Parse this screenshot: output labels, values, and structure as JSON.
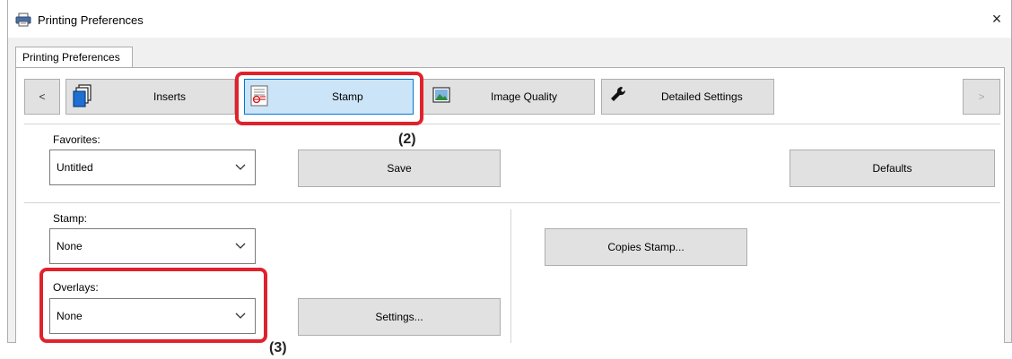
{
  "window": {
    "title": "Printing Preferences",
    "close_glyph": "×"
  },
  "tab": {
    "label": "Printing Preferences"
  },
  "toolbar": {
    "prev_label": "<",
    "next_label": ">",
    "tabs": [
      {
        "label": "Inserts",
        "icon": "pages-icon"
      },
      {
        "label": "Stamp",
        "icon": "stamp-icon",
        "selected": true
      },
      {
        "label": "Image Quality",
        "icon": "image-quality-icon"
      },
      {
        "label": "Detailed Settings",
        "icon": "wrench-icon"
      }
    ]
  },
  "favorites": {
    "label": "Favorites:",
    "value": "Untitled",
    "save_label": "Save",
    "defaults_label": "Defaults"
  },
  "stamp": {
    "label": "Stamp:",
    "value": "None",
    "copies_stamp_label": "Copies Stamp..."
  },
  "overlays": {
    "label": "Overlays:",
    "value": "None",
    "settings_label": "Settings..."
  },
  "annotations": {
    "callout_2": "(2)",
    "callout_3": "(3)",
    "callout_color": "#e0222c"
  },
  "colors": {
    "selected_bg": "#cce4f7",
    "selected_border": "#0078d7",
    "button_bg": "#e1e1e1"
  }
}
